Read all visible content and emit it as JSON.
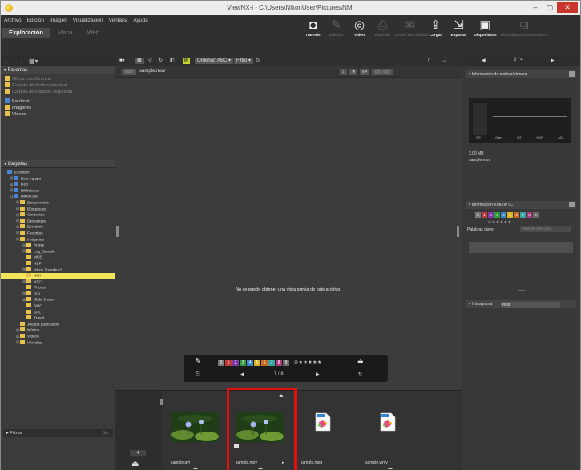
{
  "window": {
    "title": "ViewNX-i - C:\\Users\\NikonUser\\Pictures\\NMI",
    "minimize_glyph": "–",
    "maximize_glyph": "▢",
    "close_glyph": "✕"
  },
  "menubar": [
    "Archivo",
    "Edición",
    "Imagen",
    "Visualización",
    "Ventana",
    "Ayuda"
  ],
  "mode_tabs": [
    {
      "label": "Exploración",
      "active": true
    },
    {
      "label": "Mapa",
      "active": false
    },
    {
      "label": "Web",
      "active": false
    }
  ],
  "toolbar": [
    {
      "label": "Transfer",
      "icon": "camera-icon",
      "glyph": "◘",
      "enabled": true
    },
    {
      "label": "Edición",
      "icon": "edit-icon",
      "glyph": "✎",
      "enabled": false
    },
    {
      "label": "Vídeo",
      "icon": "video-icon",
      "glyph": "◎",
      "enabled": true
    },
    {
      "label": "Imprimir",
      "icon": "printer-icon",
      "glyph": "⎙",
      "enabled": false
    },
    {
      "label": "Correo electrónico",
      "icon": "mail-icon",
      "glyph": "✉",
      "enabled": false
    },
    {
      "label": "Cargar",
      "icon": "upload-icon",
      "glyph": "⇪",
      "enabled": true
    },
    {
      "label": "Exportar",
      "icon": "export-icon",
      "glyph": "⇲",
      "enabled": true
    },
    {
      "label": "Diapositivas",
      "icon": "slideshow-icon",
      "glyph": "▣",
      "enabled": true
    },
    {
      "label": "Reproducción automática",
      "icon": "autoplay-icon",
      "glyph": "⧉",
      "enabled": false
    }
  ],
  "left_panel": {
    "nav_glyphs": {
      "back": "←",
      "forward": "→",
      "view": "▦▾"
    },
    "favorites_header": "▾ Favoritas",
    "favorites": [
      {
        "label": "Última transferencia",
        "enabled": false
      },
      {
        "label": "Carpeta de destino principal",
        "enabled": false
      },
      {
        "label": "Carpeta de copia de seguridad",
        "enabled": false
      },
      {
        "label": "Escritorio",
        "enabled": true
      },
      {
        "label": "Imágenes",
        "enabled": true
      },
      {
        "label": "Vídeos",
        "enabled": true
      }
    ],
    "folders_header": "▾ Carpetas",
    "tree": [
      {
        "label": "Escritorio",
        "level": 0,
        "exp": ""
      },
      {
        "label": "Este equipo",
        "level": 1,
        "exp": "⊞"
      },
      {
        "label": "Red",
        "level": 1,
        "exp": "⊞"
      },
      {
        "label": "Bibliotecas",
        "level": 1,
        "exp": "⊞"
      },
      {
        "label": "NikonUser",
        "level": 1,
        "exp": "⊟"
      },
      {
        "label": "Documentos",
        "level": 2,
        "exp": "⊞"
      },
      {
        "label": "Búsquedas",
        "level": 2,
        "exp": "⊞"
      },
      {
        "label": "Contactos",
        "level": 2,
        "exp": "⊞"
      },
      {
        "label": "Descargas",
        "level": 2,
        "exp": "⊞"
      },
      {
        "label": "Escritorio",
        "level": 2,
        "exp": "⊞"
      },
      {
        "label": "Favoritos",
        "level": 2,
        "exp": "⊞"
      },
      {
        "label": "Imágenes",
        "level": 2,
        "exp": "⊟"
      },
      {
        "label": "Ansys",
        "level": 3,
        "exp": "⊞"
      },
      {
        "label": "Log_Sample",
        "level": 3,
        "exp": "⊞"
      },
      {
        "label": "MOS",
        "level": 3,
        "exp": ""
      },
      {
        "label": "NEF",
        "level": 3,
        "exp": ""
      },
      {
        "label": "Nikon Transfer 2",
        "level": 3,
        "exp": "⊞"
      },
      {
        "label": "NMI",
        "level": 3,
        "exp": "",
        "selected": true
      },
      {
        "label": "NTC",
        "level": 3,
        "exp": "⊞"
      },
      {
        "label": "Photos",
        "level": 3,
        "exp": ""
      },
      {
        "label": "PCI",
        "level": 3,
        "exp": "⊞"
      },
      {
        "label": "Slide Shows",
        "level": 3,
        "exp": "⊞"
      },
      {
        "label": "SMC",
        "level": 3,
        "exp": ""
      },
      {
        "label": "SPL",
        "level": 3,
        "exp": ""
      },
      {
        "label": "Travel",
        "level": 3,
        "exp": ""
      },
      {
        "label": "Juegos guardados",
        "level": 2,
        "exp": ""
      },
      {
        "label": "Música",
        "level": 2,
        "exp": "⊞"
      },
      {
        "label": "Vídeos",
        "level": 2,
        "exp": "⊞"
      },
      {
        "label": "Vínculos",
        "level": 2,
        "exp": "⊞"
      }
    ],
    "filter_label": "▸ Filtros",
    "filter_clear": "Bor"
  },
  "center": {
    "sort_label": "Ordenar: ABC ▾",
    "filter_label": "Filtro ▾",
    "view_glyph": "■▾",
    "path_tag": "MOV",
    "file_name": "sample.mov",
    "path_tools": [
      "1",
      "◥",
      "⊞▾",
      "◁ ▷ ◁ ▷"
    ],
    "no_preview": "No se puede obtener una vista previa de este archivo.",
    "hud": {
      "pen_glyph": "✎",
      "stars": "⊘★★★★★",
      "protect_glyph": "⏏",
      "counter": "7 / 8",
      "prev_glyph": "◀",
      "next_glyph": "▶",
      "left_glyph": "⎘",
      "right_glyph": "↻"
    }
  },
  "labels": [
    {
      "n": "0",
      "color": "#7a7a7a"
    },
    {
      "n": "1",
      "color": "#c23a3a"
    },
    {
      "n": "2",
      "color": "#7a3aa8"
    },
    {
      "n": "3",
      "color": "#2f9a3a"
    },
    {
      "n": "4",
      "color": "#3a84c9"
    },
    {
      "n": "5",
      "color": "#d9b21f"
    },
    {
      "n": "6",
      "color": "#c96a1f"
    },
    {
      "n": "7",
      "color": "#3aa3a3"
    },
    {
      "n": "8",
      "color": "#a83a7a"
    },
    {
      "n": "9",
      "color": "#6a6a6a"
    }
  ],
  "filmstrip": {
    "zoom_value": "4",
    "items": [
      {
        "name": "sample.avi",
        "kind": "photo"
      },
      {
        "name": "sample.mov",
        "kind": "photo",
        "selected": true
      },
      {
        "name": "sample.mpg",
        "kind": "file"
      },
      {
        "name": "sample.wmv",
        "kind": "file"
      }
    ],
    "sub_glyph": "▬"
  },
  "right_panel": {
    "nav_prev": "◀",
    "nav_counter": "2 / 4",
    "nav_next": "▶",
    "info_header": "▾ Información de archivo/cámara",
    "histo_labels": [
      "RR",
      "Gam",
      "WT",
      "HDR",
      "ADL"
    ],
    "file_size": "2.00 MB",
    "file_name": "sample.mov",
    "xmp_header": "▾ Información XMP/IPTC",
    "stars": "⊘★★★★★",
    "keywords_label": "Palabras clave:",
    "keywords_placeholder": "Palabras clave para...",
    "histogram_header": "▾ Histograma",
    "histogram_channel": "RGB"
  },
  "colors": {
    "selection_border": "#e20f0f",
    "tree_selected": "#f2e55a"
  }
}
